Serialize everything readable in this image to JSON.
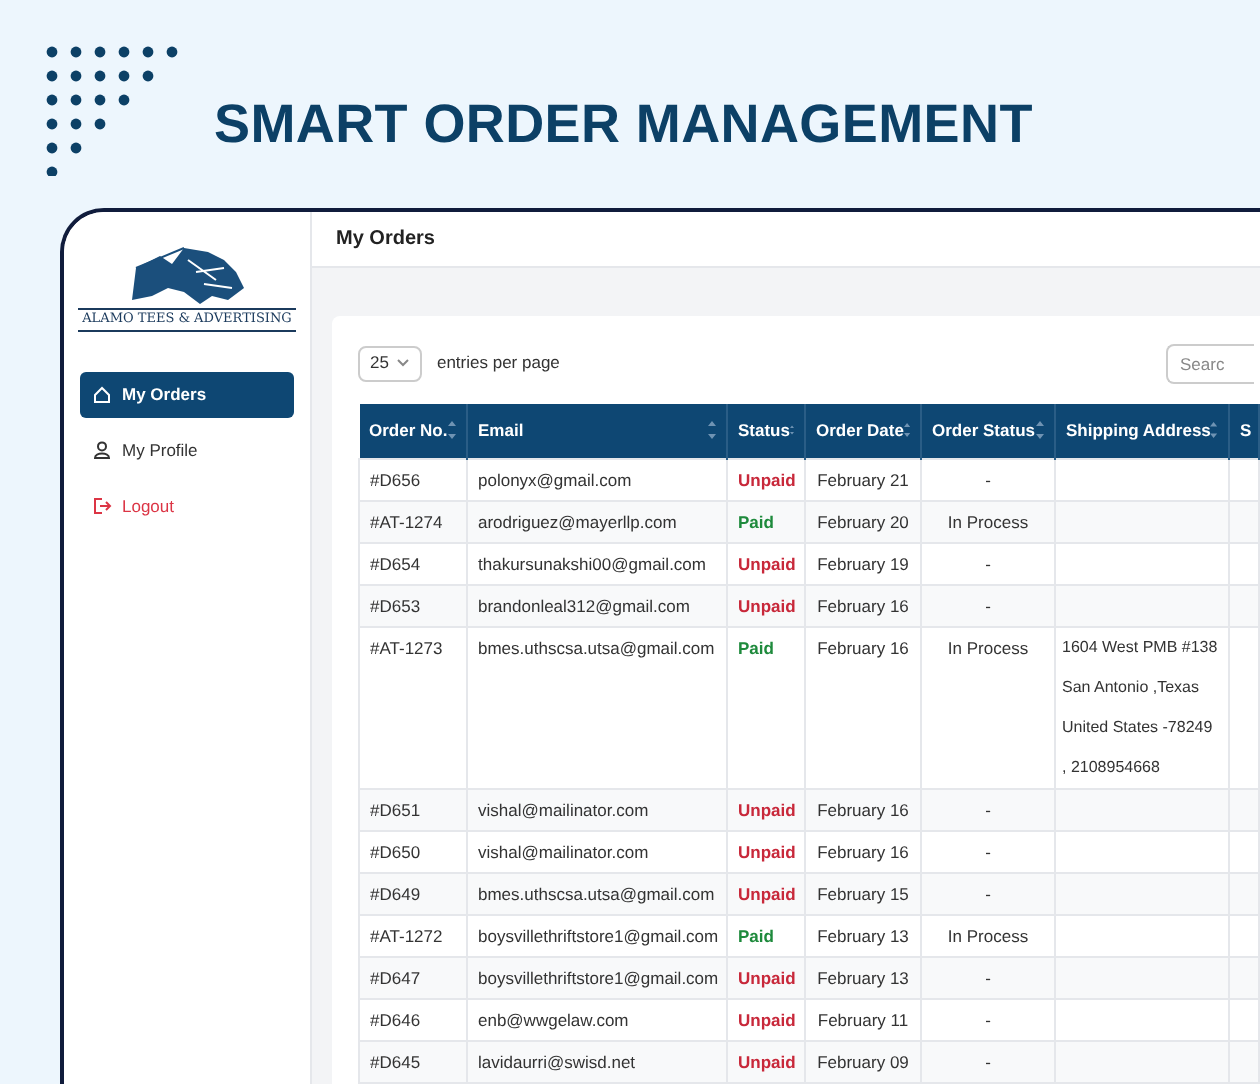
{
  "headline": "SMART ORDER MANAGEMENT",
  "app": {
    "logo_text": "ALAMO TEES & ADVERTISING",
    "sidebar": {
      "items": [
        {
          "label": "My Orders",
          "kind": "orders",
          "selected": true
        },
        {
          "label": "My Profile",
          "kind": "profile",
          "selected": false
        },
        {
          "label": "Logout",
          "kind": "logout",
          "selected": false
        }
      ]
    },
    "page_title": "My Orders",
    "page_size": "25",
    "entries_label": "entries per page",
    "search": {
      "placeholder": "Searc"
    },
    "table": {
      "columns": [
        "Order No.",
        "Email",
        "Status",
        "Order Date",
        "Order Status",
        "Shipping Address",
        "S"
      ],
      "rows": [
        {
          "order_no": "#D656",
          "email": "polonyx@gmail.com",
          "status": {
            "text": "Unpaid",
            "kind": "unpaid"
          },
          "date": "February 21",
          "order_status": "-",
          "address": []
        },
        {
          "order_no": "#AT-1274",
          "email": "arodriguez@mayerllp.com",
          "status": {
            "text": "Paid",
            "kind": "paid"
          },
          "date": "February 20",
          "order_status": "In Process",
          "address": []
        },
        {
          "order_no": "#D654",
          "email": "thakursunakshi00@gmail.com",
          "status": {
            "text": "Unpaid",
            "kind": "unpaid"
          },
          "date": "February 19",
          "order_status": "-",
          "address": []
        },
        {
          "order_no": "#D653",
          "email": "brandonleal312@gmail.com",
          "status": {
            "text": "Unpaid",
            "kind": "unpaid"
          },
          "date": "February 16",
          "order_status": "-",
          "address": []
        },
        {
          "order_no": "#AT-1273",
          "email": "bmes.uthscsa.utsa@gmail.com",
          "status": {
            "text": "Paid",
            "kind": "paid"
          },
          "date": "February 16",
          "order_status": "In Process",
          "address": [
            "1604 West PMB #138",
            "San Antonio ,Texas",
            "United States -78249",
            ", 2108954668"
          ]
        },
        {
          "order_no": "#D651",
          "email": "vishal@mailinator.com",
          "status": {
            "text": "Unpaid",
            "kind": "unpaid"
          },
          "date": "February 16",
          "order_status": "-",
          "address": []
        },
        {
          "order_no": "#D650",
          "email": "vishal@mailinator.com",
          "status": {
            "text": "Unpaid",
            "kind": "unpaid"
          },
          "date": "February 16",
          "order_status": "-",
          "address": []
        },
        {
          "order_no": "#D649",
          "email": "bmes.uthscsa.utsa@gmail.com",
          "status": {
            "text": "Unpaid",
            "kind": "unpaid"
          },
          "date": "February 15",
          "order_status": "-",
          "address": []
        },
        {
          "order_no": "#AT-1272",
          "email": "boysvillethriftstore1@gmail.com",
          "status": {
            "text": "Paid",
            "kind": "paid"
          },
          "date": "February 13",
          "order_status": "In Process",
          "address": []
        },
        {
          "order_no": "#D647",
          "email": "boysvillethriftstore1@gmail.com",
          "status": {
            "text": "Unpaid",
            "kind": "unpaid"
          },
          "date": "February 13",
          "order_status": "-",
          "address": []
        },
        {
          "order_no": "#D646",
          "email": "enb@wwgelaw.com",
          "status": {
            "text": "Unpaid",
            "kind": "unpaid"
          },
          "date": "February 11",
          "order_status": "-",
          "address": []
        },
        {
          "order_no": "#D645",
          "email": "lavidaurri@swisd.net",
          "status": {
            "text": "Unpaid",
            "kind": "unpaid"
          },
          "date": "February 09",
          "order_status": "-",
          "address": []
        }
      ]
    }
  }
}
